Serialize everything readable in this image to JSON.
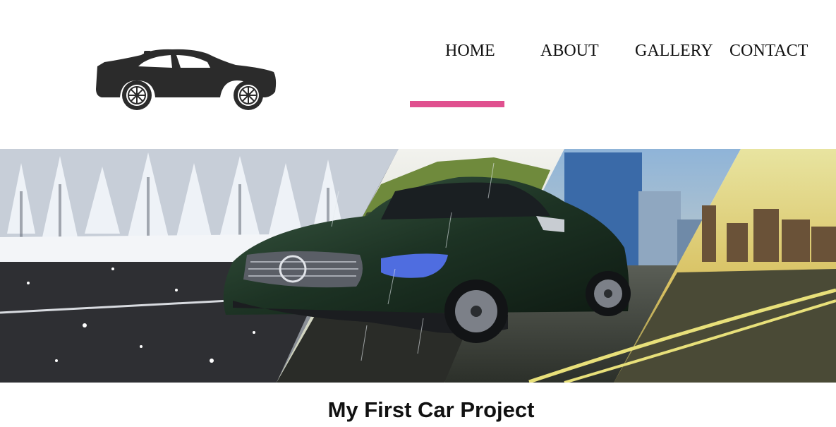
{
  "nav": {
    "items": [
      {
        "label": "HOME",
        "active": true
      },
      {
        "label": "ABOUT"
      },
      {
        "label": "GALLERY"
      },
      {
        "label": "CONTACT"
      }
    ],
    "active_indicator_color": "#e0508f"
  },
  "logo": {
    "icon": "car-icon",
    "color": "#2b2b2b"
  },
  "hero": {
    "image": "sports-car-weather-collage"
  },
  "page": {
    "title": "My First Car Project"
  }
}
